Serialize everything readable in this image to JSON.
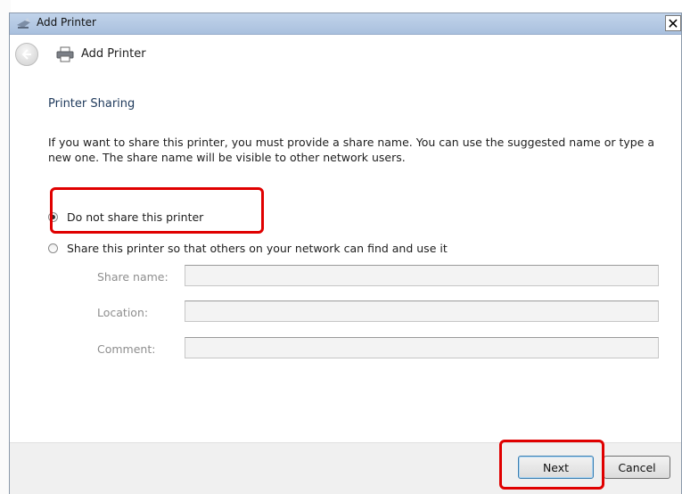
{
  "window": {
    "title": "Add Printer",
    "close_glyph": "✕"
  },
  "nav": {
    "title": "Add Printer"
  },
  "page": {
    "heading": "Printer Sharing",
    "description": "If you want to share this printer, you must provide a share name. You can use the suggested name or type a new one. The share name will be visible to other network users.",
    "options": [
      {
        "label": "Do not share this printer",
        "checked": true
      },
      {
        "label": "Share this printer so that others on your network can find and use it",
        "checked": false
      }
    ],
    "fields": [
      {
        "label": "Share name:",
        "value": ""
      },
      {
        "label": "Location:",
        "value": ""
      },
      {
        "label": "Comment:",
        "value": ""
      }
    ]
  },
  "footer": {
    "next_label": "Next",
    "cancel_label": "Cancel"
  },
  "annotations": {
    "highlight_color": "#e00000"
  },
  "icons": {
    "title": "printer-wizard-icon",
    "back": "back-arrow-icon",
    "nav": "printer-icon",
    "close": "close-icon"
  }
}
